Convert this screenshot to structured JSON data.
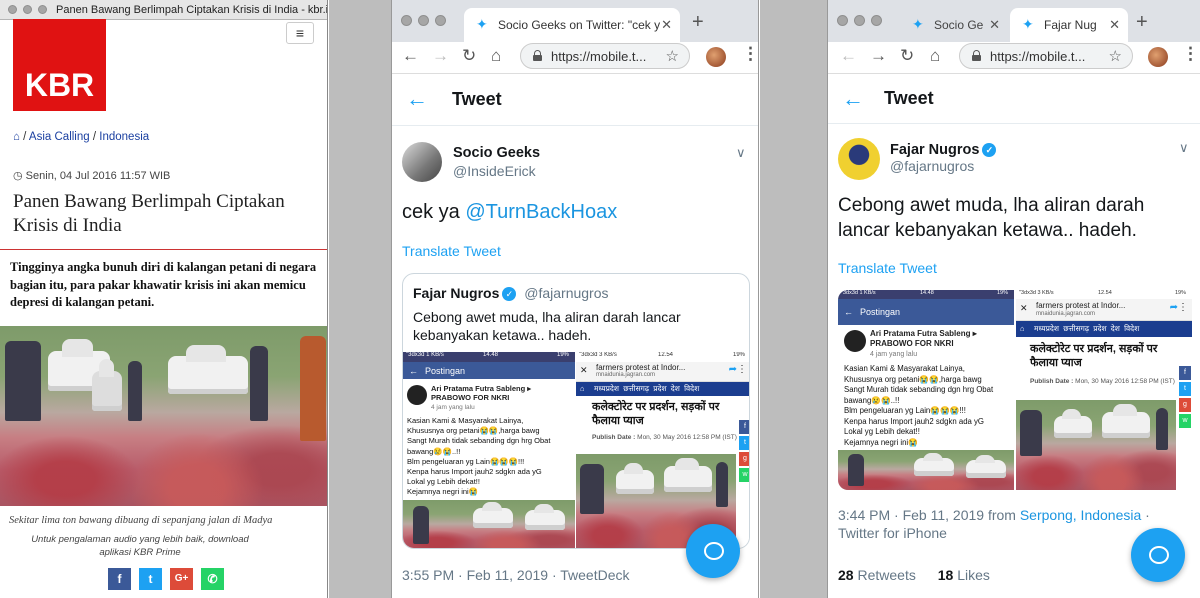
{
  "left_window": {
    "title": "Panen Bawang Berlimpah Ciptakan Krisis di India - kbr.id",
    "logo": "KBR",
    "menu_icon": "≡",
    "breadcrumb": {
      "home_icon": "home-icon",
      "items": [
        "Asia Calling",
        "Indonesia"
      ],
      "separator": "/"
    },
    "date": "Senin, 04 Jul 2016 11:57 WIB",
    "headline": "Panen Bawang Berlimpah Ciptakan Krisis di India",
    "lede": "Tingginya angka bunuh diri di kalangan petani di negara bagian itu, para pakar khawatir krisis ini akan memicu depresi di kalangan petani.",
    "caption": "Sekitar lima ton bawang dibuang di sepanjang jalan di Madya",
    "promo": "Untuk pengalaman audio yang lebih baik, download aplikasi KBR Prime",
    "share": [
      {
        "label": "f",
        "color": "#3b5998",
        "icon": "facebook-icon"
      },
      {
        "label": "t",
        "color": "#1da1f2",
        "icon": "twitter-icon"
      },
      {
        "label": "G+",
        "color": "#dd4b39",
        "icon": "google-plus-icon"
      },
      {
        "label": "✆",
        "color": "#25d366",
        "icon": "whatsapp-icon"
      }
    ]
  },
  "middle_window": {
    "tab_title": "Socio Geeks on Twitter: \"cek y",
    "url": "https://mobile.t...",
    "header_title": "Tweet",
    "author_name": "Socio Geeks",
    "author_handle": "@InsideErick",
    "tweet_text_prefix": "cek ya ",
    "tweet_mention": "@TurnBackHoax",
    "translate": "Translate Tweet",
    "quote": {
      "name": "Fajar Nugros",
      "handle": "@fajarnugros",
      "text": "Cebong awet muda, lha aliran darah lancar kebanyakan ketawa.. hadeh."
    },
    "timestamp": "3:55 PM · Feb 11, 2019 · TweetDeck"
  },
  "right_window": {
    "tabs": [
      {
        "title": "Socio Ge"
      },
      {
        "title": "Fajar Nug"
      }
    ],
    "url": "https://mobile.t...",
    "header_title": "Tweet",
    "author_name": "Fajar Nugros",
    "author_handle": "@fajarnugros",
    "tweet_text": "Cebong awet muda, lha aliran darah lancar kebanyakan ketawa.. hadeh.",
    "translate": "Translate Tweet",
    "meta_time": "3:44 PM · Feb 11, 2019 from ",
    "meta_location": "Serpong, Indonesia",
    "meta_sep": " · ",
    "meta_source": "Twitter for iPhone",
    "retweets_count": "28",
    "retweets_label": "Retweets",
    "likes_count": "18",
    "likes_label": "Likes"
  },
  "shot_fb": {
    "status_left": "\"3dx3d 1 KB/s",
    "status_time": "14.48",
    "status_right": "19%",
    "bar_title": "Postingan",
    "poster": "Ari Pratama Futra Sableng ▸ PRABOWO FOR NKRI",
    "poster_time": "4 jam yang lalu",
    "post_text": "Kasian Kami & Masyarakat Lainya,\nKhususnya org petani😭😭,harga bawg\nSangt Murah tidak sebanding dgn hrg Obat\nbawang😢😭..!!\nBlm pengeluaran yg Lain😭😭😭!!!\nKenpa harus Import jauh2 sdgkn ada yG\nLokal yg Lebih dekat!!\nKejamnya negri ini😭"
  },
  "shot_news": {
    "status_left": "\"3dx3d 3 KB/s",
    "status_time": "12.54",
    "status_right": "19%",
    "page_title": "farmers protest at Indor...",
    "page_url": "mnaidunia.jagran.com",
    "nav": [
      "मध्यप्रदेश",
      "छत्तीसगढ़",
      "प्रदेश",
      "देश",
      "विदेश"
    ],
    "headline": "कलेक्टोरेट पर प्रदर्शन, सड़कों पर फैलाया प्याज",
    "publish_label": "Publish Date :",
    "publish_date": "Mon, 30 May 2016 12:58 PM (IST)"
  }
}
